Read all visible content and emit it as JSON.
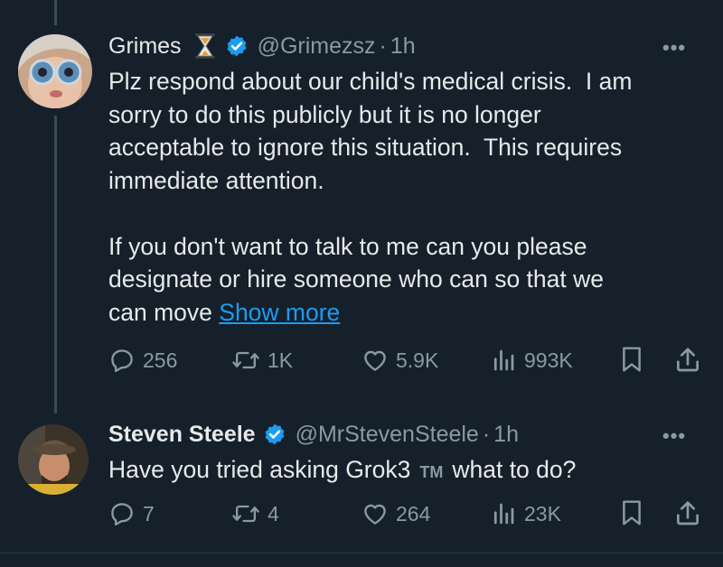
{
  "tweets": [
    {
      "display_name": "Grimes",
      "emoji": "⌛",
      "handle": "@Grimezsz",
      "sep": "·",
      "time": "1h",
      "body": "Plz respond about our child's medical crisis.  I am\nsorry to do this publicly but it is no longer\nacceptable to ignore this situation.  This requires\nimmediate attention.\n\nIf you don't want to talk to me can you please\ndesignate or hire someone who can so that we\ncan move ",
      "show_more": "Show more",
      "replies": "256",
      "reposts": "1K",
      "likes": "5.9K",
      "views": "993K"
    },
    {
      "display_name": "Steven Steele",
      "handle": "@MrStevenSteele",
      "sep": "·",
      "time": "1h",
      "body_before": "Have you tried asking Grok3",
      "tm": "TM",
      "body_after": "what to do?",
      "replies": "7",
      "reposts": "4",
      "likes": "264",
      "views": "23K"
    }
  ],
  "more_icon": "•••",
  "colors": {
    "background": "#15202b",
    "text": "#e7e9ea",
    "muted": "#8b98a5",
    "link": "#1d9bf0",
    "verified": "#1d9bf0"
  }
}
